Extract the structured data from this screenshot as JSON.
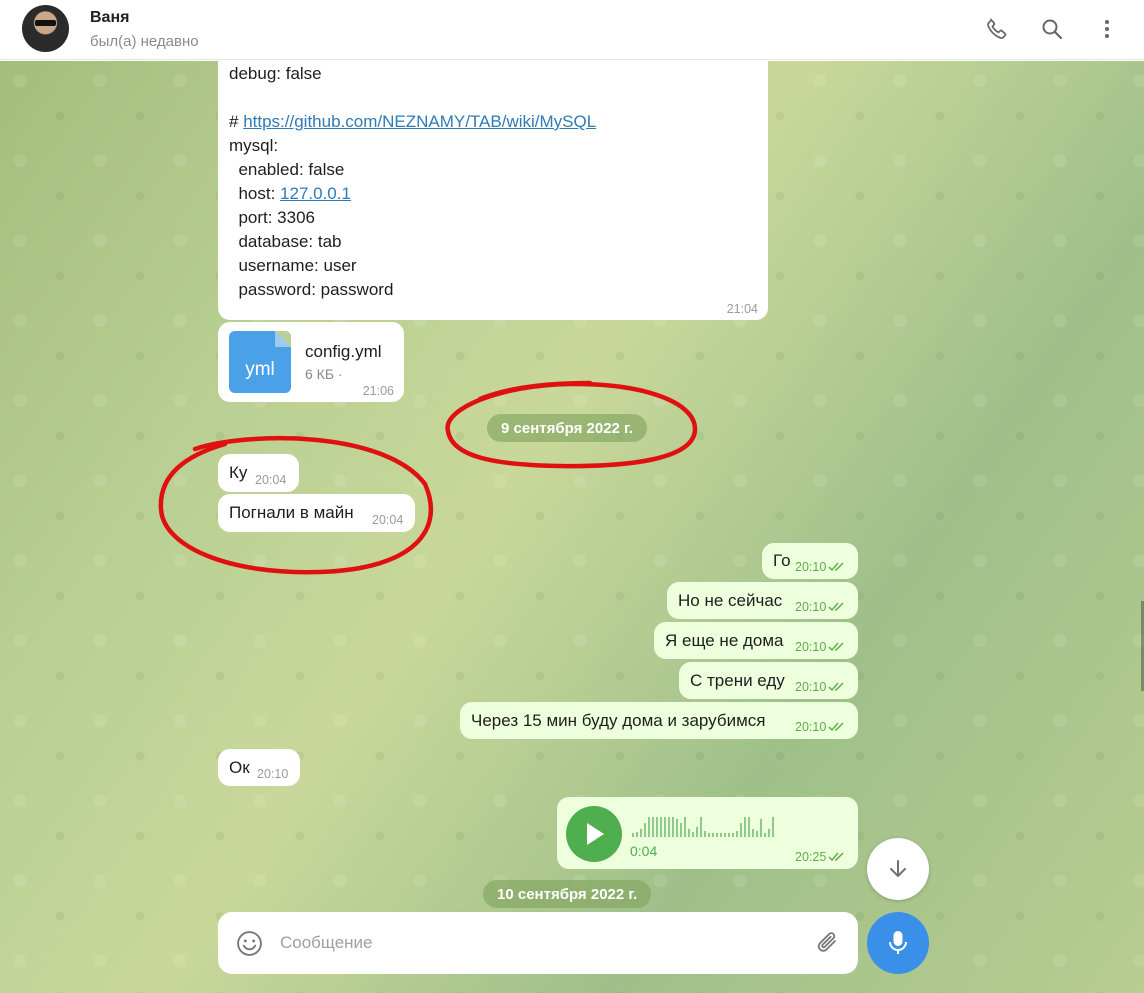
{
  "header": {
    "name": "Ваня",
    "status": "был(а) недавно",
    "icons": [
      "phone-icon",
      "search-icon",
      "more-vertical-icon"
    ]
  },
  "code_message": {
    "lines": [
      "debug: false",
      "",
      "# ",
      "mysql:",
      "  enabled: false",
      "  host: ",
      "  port: 3306",
      "  database: tab",
      "  username: user",
      "  password: password"
    ],
    "link": "https://github.com/NEZNAMY/TAB/wiki/MySQL",
    "host_link": "127.0.0.1",
    "time": "21:04"
  },
  "file_message": {
    "ext": "yml",
    "name": "config.yml",
    "size": "6 КБ ·",
    "time": "21:06"
  },
  "date1": "9 сентября 2022 г.",
  "date2": "10 сентября 2022 г.",
  "incoming": [
    {
      "text": "Ку",
      "time": "20:04"
    },
    {
      "text": "Погнали в майн",
      "time": "20:04"
    },
    {
      "text": "Ок",
      "time": "20:10"
    }
  ],
  "outgoing": [
    {
      "text": "Го",
      "time": "20:10"
    },
    {
      "text": "Но не сейчас",
      "time": "20:10"
    },
    {
      "text": "Я еще не дома",
      "time": "20:10"
    },
    {
      "text": "С трени еду",
      "time": "20:10"
    },
    {
      "text": "Через 15 мин буду дома и зарубимся",
      "time": "20:10"
    }
  ],
  "voice": {
    "duration": "0:04",
    "time": "20:25"
  },
  "composer": {
    "placeholder": "Сообщение"
  },
  "colors": {
    "accent": "#3a8fe8",
    "outgoing_bubble": "#eeffde",
    "play": "#4fae4e",
    "annotation": "#e01010"
  }
}
